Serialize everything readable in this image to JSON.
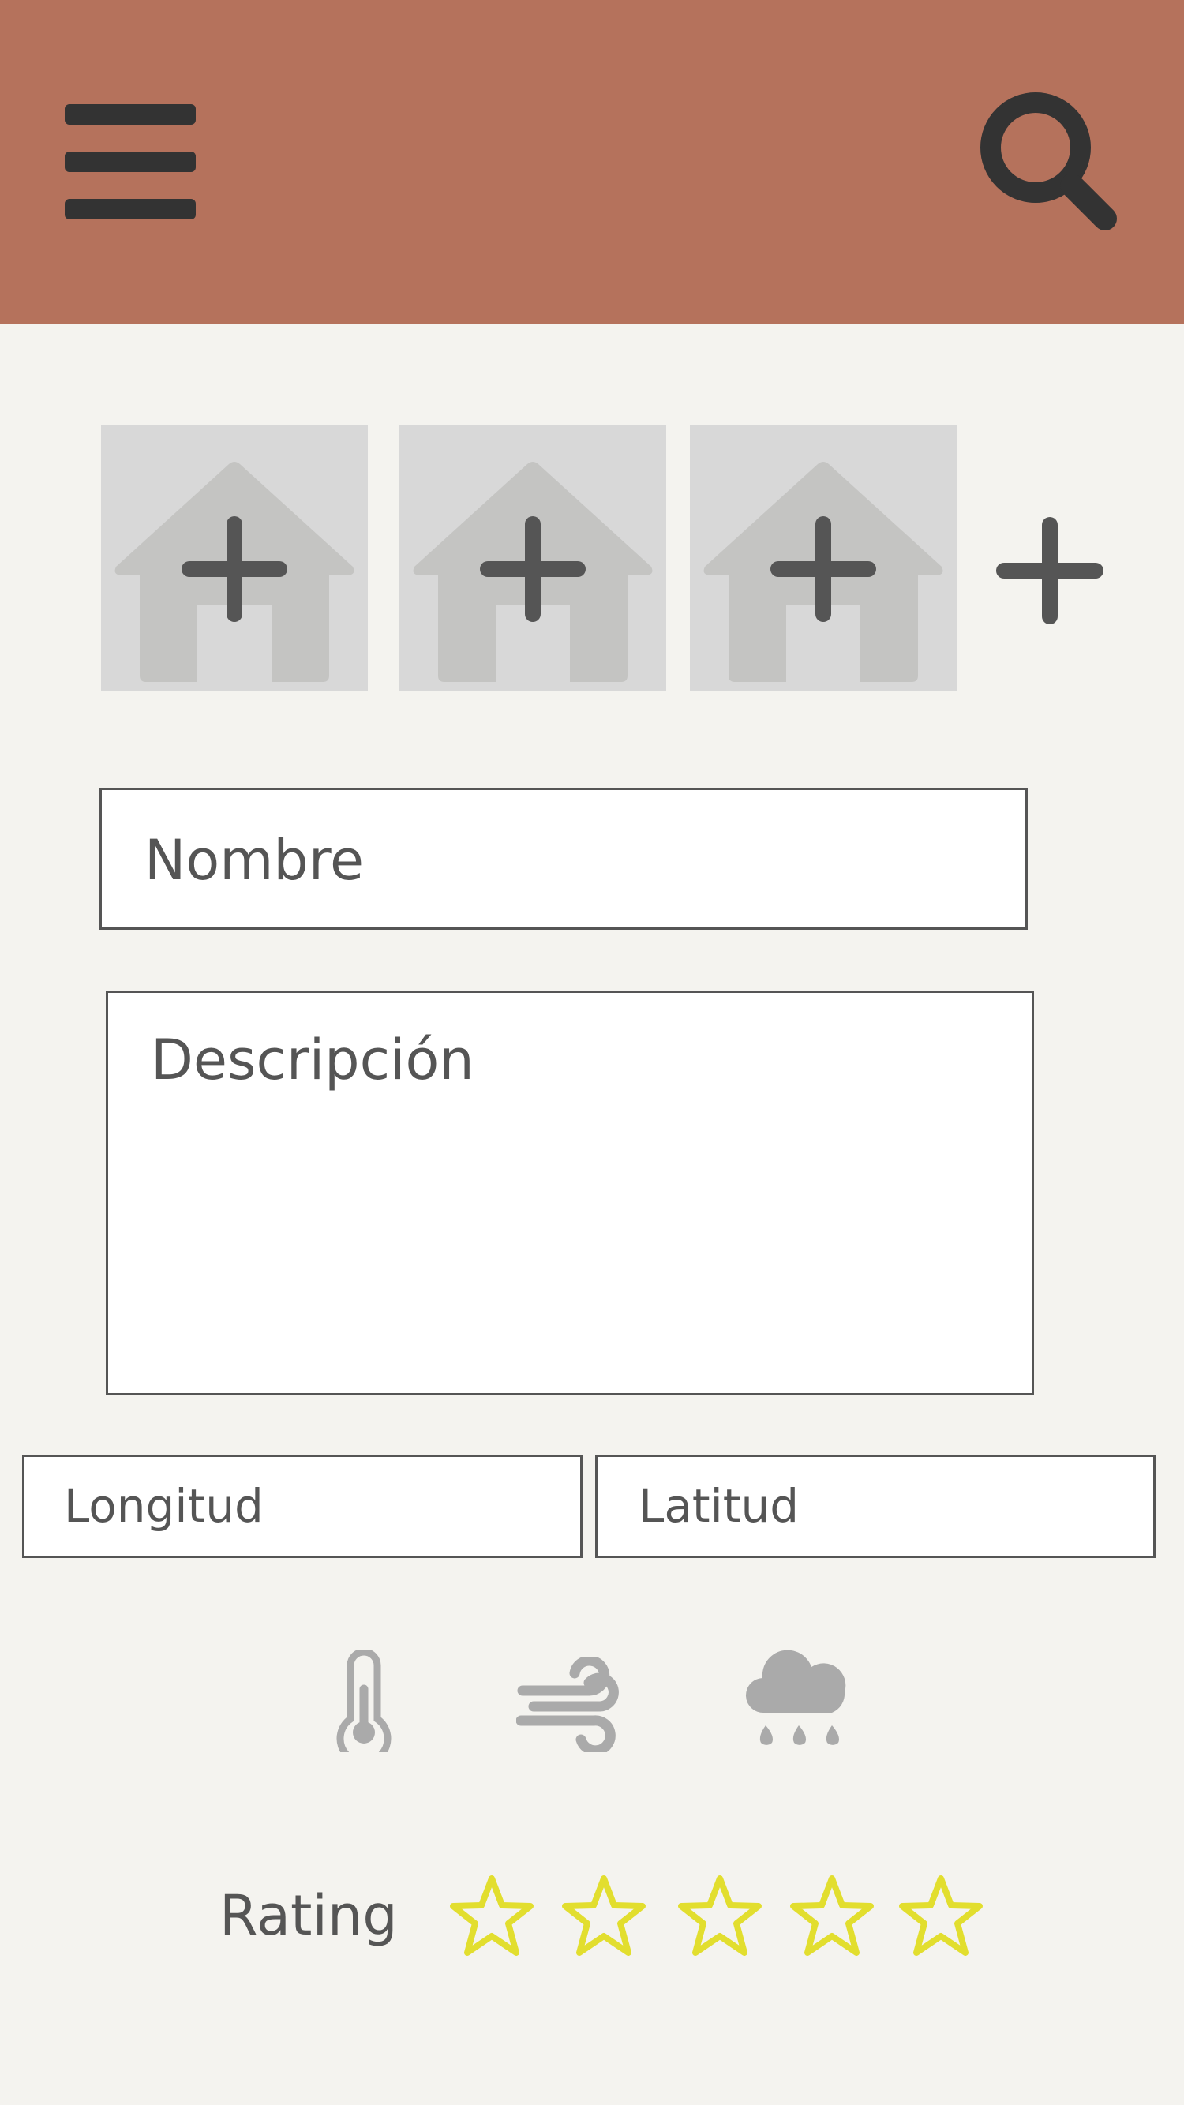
{
  "header": {
    "background_color": "#b5725c",
    "menu_icon": "hamburger-menu-icon",
    "search_icon": "search-icon"
  },
  "photos": {
    "slots": [
      {
        "icon": "house-add-photo-icon"
      },
      {
        "icon": "house-add-photo-icon"
      },
      {
        "icon": "house-add-photo-icon"
      }
    ],
    "add_icon": "plus-icon"
  },
  "form": {
    "name_placeholder": "Nombre",
    "description_placeholder": "Descripción",
    "longitude_placeholder": "Longitud",
    "latitude_placeholder": "Latitud"
  },
  "weather": {
    "icons": [
      "thermometer-icon",
      "wind-icon",
      "rain-cloud-icon"
    ],
    "icon_color": "#aaaaaa"
  },
  "rating": {
    "label": "Rating",
    "max_stars": 5,
    "value": 0,
    "star_color": "#e2de2e"
  }
}
